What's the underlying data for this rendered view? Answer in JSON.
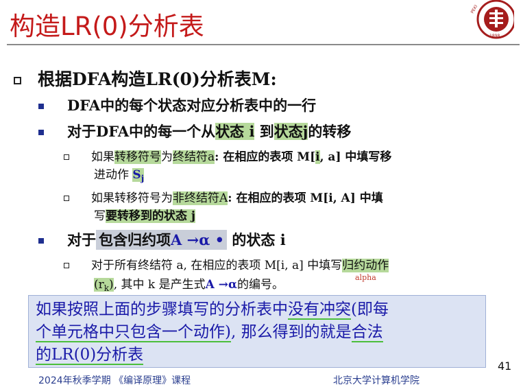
{
  "title": "构造LR(0)分析表",
  "logo": {
    "name": "peking-university-seal",
    "text_top": "PEKING UNIVERSITY",
    "year": "1898"
  },
  "main_bullet": "根据DFA构造LR(0)分析表M:",
  "items": {
    "row_rule": "DFA中的每个状态对应分析表中的一行",
    "transition_intro": {
      "p1": "对于DFA中的每一个从",
      "h1": "状态 i",
      "p2": " 到",
      "h2": "状态j",
      "p3": "的转移"
    },
    "terminal": {
      "p1": "如果",
      "h1": "转移符号",
      "p2": "为",
      "h2": "终结符a",
      "p3": ": 在相应的表项 M[",
      "h3": "i",
      "p4": ", a] 中填写移",
      "line2": "进动作 ",
      "shift": "S",
      "shift_sub": "j"
    },
    "nonterminal": {
      "p1": "如果转移符号为",
      "h1": "非终结符A",
      "p2": ": 在相应的表项 M[i, A] 中填",
      "line2_p": "写",
      "line2_h": "要转移到的状态 j"
    },
    "reduce_intro": {
      "p1": "对于",
      "h1": "包含归约项",
      "blue": "A →α •",
      "p2": " 的状态 i"
    },
    "reduce_rule": {
      "p1": "对于所有终结符 a, 在相应的表项 M[i, a] 中填写",
      "h1": "归约动作",
      "line2_h": "(r",
      "line2_sub": "k",
      "line2_h2": ")",
      "line2_p": ", 其中 k 是产生式",
      "line2_blue": "A →α",
      "line2_p2": "的编号。"
    }
  },
  "alpha_note": "alpha",
  "callout": {
    "t1": "如果按照上面的步骤填写的分析表中",
    "u1": "没有冲突",
    "t2": "(即每",
    "u2": "个单元格中只包含一个动作)",
    "t3": ", 那么得到的就是",
    "u3": "合法",
    "u4": "的LR(0)分析表"
  },
  "page_number": "41",
  "footer_left": "2024年秋季学期 《编译原理》课程",
  "footer_right": "北京大学计算机学院"
}
